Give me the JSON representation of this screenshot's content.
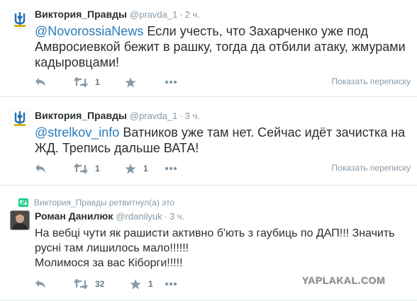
{
  "tweets": [
    {
      "name": "Виктория_Правды",
      "handle": "@pravda_1",
      "sep": "·",
      "time": "2 ч.",
      "mention": "@NovorossiaNews",
      "body": " Если учесть, что Захарченко уже под Амвросиевкой бежит в рашку, тогда да отбили атаку, жмурами кадыровцами!",
      "retweets": "1",
      "favorites": "",
      "convo": "Показать переписку"
    },
    {
      "name": "Виктория_Правды",
      "handle": "@pravda_1",
      "sep": "·",
      "time": "3 ч.",
      "mention": "@strelkov_info",
      "body": " Ватников уже там нет. Сейчас идёт зачистка на ЖД. Трепись дальше ВАТА!",
      "retweets": "1",
      "favorites": "1",
      "convo": "Показать переписку"
    },
    {
      "retweet_note": "Виктория_Правды ретвитнул(а) это",
      "name": "Роман Данилюк",
      "handle": "@rdanilyuk",
      "sep": "·",
      "time": "3 ч.",
      "body_lines": [
        "На вебці чути як рашисти активно б'ють з гаубиць по ДАП!!! Значить",
        "русні там лишилось мало!!!!!!",
        "Молимося за вас Кіборги!!!!!"
      ],
      "retweets": "32",
      "favorites": "1"
    }
  ],
  "watermark": "YAPLAKAL.COM",
  "icons": {
    "reply": "reply-icon",
    "retweet": "retweet-icon",
    "favorite": "star-icon",
    "more": "more-icon"
  },
  "colors": {
    "link": "#2b7bb9",
    "meta": "#8899a6",
    "text": "#292f33",
    "retweet_green": "#19cf86"
  }
}
